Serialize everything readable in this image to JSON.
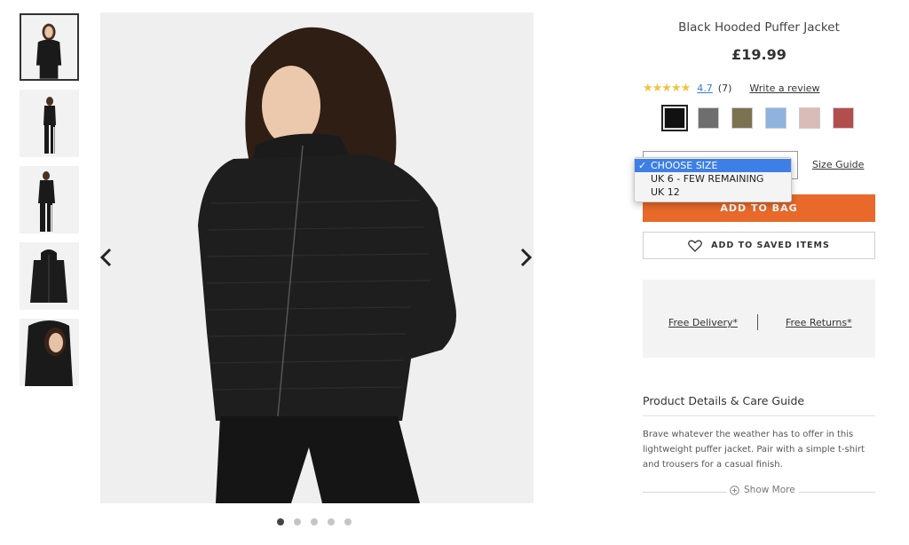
{
  "product": {
    "title": "Black Hooded Puffer Jacket",
    "price": "£19.99"
  },
  "rating": {
    "stars": "★★★★★",
    "value": "4.7",
    "count": "(7)",
    "write_review": "Write a review"
  },
  "swatches": [
    {
      "name": "black",
      "color": "#111111"
    },
    {
      "name": "grey",
      "color": "#6e6e6e"
    },
    {
      "name": "khaki",
      "color": "#7a7251"
    },
    {
      "name": "light-blue",
      "color": "#8fb3de"
    },
    {
      "name": "pink",
      "color": "#d9bcb5"
    },
    {
      "name": "red",
      "color": "#b24e4e"
    }
  ],
  "size": {
    "options": [
      {
        "label": "CHOOSE SIZE",
        "selected": true,
        "check": "✓"
      },
      {
        "label": "UK 6 - FEW REMAINING",
        "selected": false
      },
      {
        "label": "UK 12",
        "selected": false
      }
    ],
    "guide": "Size Guide"
  },
  "buttons": {
    "add_to_bag": "ADD TO BAG",
    "save": "ADD TO SAVED ITEMS"
  },
  "delivery": {
    "free_delivery": "Free Delivery*",
    "free_returns": "Free Returns*"
  },
  "details": {
    "title": "Product Details & Care Guide",
    "description": "Brave whatever the weather has to offer in this lightweight puffer jacket. Pair with a simple t-shirt and trousers for a casual finish.",
    "show_more": "Show More"
  },
  "gallery": {
    "thumbnail_count": 5,
    "active_index": 0
  },
  "colors": {
    "accent": "#e8692a",
    "link_blue": "#3a7bd5",
    "star": "#f2c443"
  }
}
